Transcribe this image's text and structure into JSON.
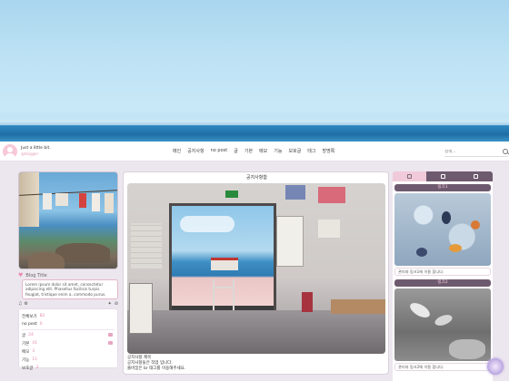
{
  "header": {
    "blog_name": "Just a little bit.",
    "blog_handle": "@blogger",
    "nav": [
      "메인",
      "공지사항",
      "no post",
      "글",
      "기본",
      "메모",
      "기능",
      "보호글",
      "태그",
      "방명록"
    ],
    "search_placeholder": "검색..."
  },
  "sidebar_left": {
    "blog_title": "Blog Title",
    "description": "Lorem ipsum dolor sit amet, consectetur adipiscing elit. Phasellus facilisis turpis feugiat, tristique enim a, commodo purus.",
    "categories": [
      {
        "label": "전체보기",
        "count": "82"
      },
      {
        "label": "no post",
        "count": "0"
      },
      {
        "label": "글",
        "count": "24"
      },
      {
        "label": "기본",
        "count": "41"
      },
      {
        "label": "메모",
        "count": "3"
      },
      {
        "label": "기능",
        "count": "11"
      },
      {
        "label": "보호글",
        "count": "3"
      }
    ]
  },
  "main": {
    "title": "공지사항함",
    "notice_title": "공지사항 제목",
    "line1": "공지사항들은 작업 입니다.",
    "line2": "줄바꿈은 br 태그를 이용해주세요."
  },
  "sidebar_right": {
    "boxes": [
      {
        "title": "링크1",
        "caption": "관리자 링크1에 이용 합니다."
      },
      {
        "title": "링크2",
        "caption": "관리자 링크2에 이용 합니다."
      }
    ]
  },
  "colors": {
    "accent_pink": "#e88bb0",
    "mauve": "#6e5a6f",
    "sea": "#2e86bf"
  }
}
